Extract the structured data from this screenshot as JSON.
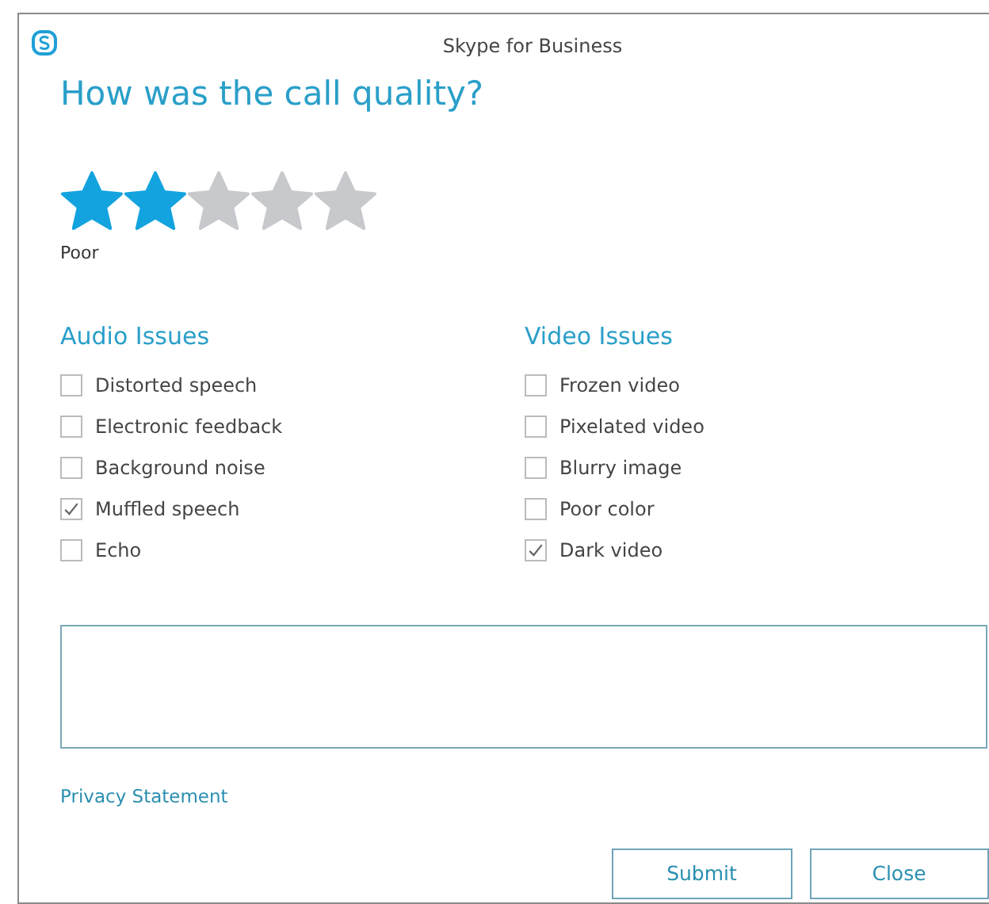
{
  "window": {
    "title": "Skype for Business"
  },
  "heading": "How was the call quality?",
  "rating": {
    "stars": 2,
    "label": "Poor"
  },
  "issue_groups": [
    {
      "title": "Audio Issues",
      "items": [
        {
          "label": "Distorted speech",
          "checked": false
        },
        {
          "label": "Electronic feedback",
          "checked": false
        },
        {
          "label": "Background noise",
          "checked": false
        },
        {
          "label": "Muffled speech",
          "checked": true
        },
        {
          "label": "Echo",
          "checked": false
        }
      ]
    },
    {
      "title": "Video Issues",
      "items": [
        {
          "label": "Frozen video",
          "checked": false
        },
        {
          "label": "Pixelated video",
          "checked": false
        },
        {
          "label": "Blurry image",
          "checked": false
        },
        {
          "label": "Poor color",
          "checked": false
        },
        {
          "label": "Dark video",
          "checked": true
        }
      ]
    }
  ],
  "privacy_link": "Privacy Statement",
  "buttons": [
    "Submit",
    "Close"
  ]
}
